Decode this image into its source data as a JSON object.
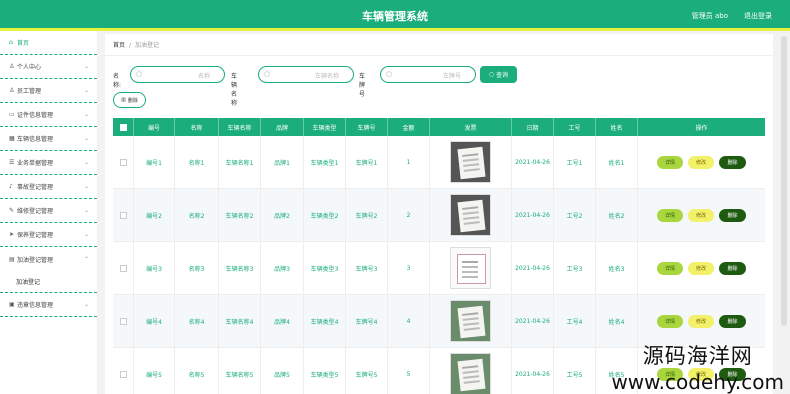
{
  "app": {
    "title": "车辆管理系统",
    "user": "管理员 abo",
    "logout": "退出登录"
  },
  "sidebar": {
    "items": [
      {
        "label": "首页",
        "icon": "home-icon"
      },
      {
        "label": "个人中心",
        "icon": "user-icon"
      },
      {
        "label": "员工管理",
        "icon": "users-icon"
      },
      {
        "label": "证件信息管理",
        "icon": "document-icon"
      },
      {
        "label": "车辆信息管理",
        "icon": "grid-icon"
      },
      {
        "label": "业务单据管理",
        "icon": "list-icon"
      },
      {
        "label": "事故登记管理",
        "icon": "mic-icon"
      },
      {
        "label": "维修登记管理",
        "icon": "wrench-icon"
      },
      {
        "label": "保养登记管理",
        "icon": "send-icon"
      },
      {
        "label": "加油登记管理",
        "icon": "fuel-icon"
      },
      {
        "label": "违章信息管理",
        "icon": "warning-icon"
      }
    ],
    "sub_item": "加油登记"
  },
  "breadcrumb": {
    "home": "首页",
    "sep": "/",
    "current": "加油登记"
  },
  "search": {
    "fields": [
      {
        "label": "名称:",
        "placeholder": "名称"
      },
      {
        "label": "车辆名称",
        "placeholder": "车辆名称"
      },
      {
        "label": "车牌号",
        "placeholder": "车牌号"
      }
    ],
    "query_label": "查询"
  },
  "toolbar": {
    "delete_label": "删除"
  },
  "table": {
    "headers": [
      "编号",
      "名称",
      "车辆名称",
      "品牌",
      "车辆类型",
      "车牌号",
      "金额",
      "发票",
      "日期",
      "工号",
      "姓名",
      "操作"
    ],
    "rows": [
      {
        "bianhao": "编号1",
        "mingcheng": "名称1",
        "cheliang": "车辆名称1",
        "pinpai": "品牌1",
        "leixing": "车辆类型1",
        "chepai": "车牌号1",
        "jine": "1",
        "riqi": "2021-04-26",
        "gonghao": "工号1",
        "xingming": "姓名1"
      },
      {
        "bianhao": "编号2",
        "mingcheng": "名称2",
        "cheliang": "车辆名称2",
        "pinpai": "品牌2",
        "leixing": "车辆类型2",
        "chepai": "车牌号2",
        "jine": "2",
        "riqi": "2021-04-26",
        "gonghao": "工号2",
        "xingming": "姓名2"
      },
      {
        "bianhao": "编号3",
        "mingcheng": "名称3",
        "cheliang": "车辆名称3",
        "pinpai": "品牌3",
        "leixing": "车辆类型3",
        "chepai": "车牌号3",
        "jine": "3",
        "riqi": "2021-04-26",
        "gonghao": "工号3",
        "xingming": "姓名3"
      },
      {
        "bianhao": "编号4",
        "mingcheng": "名称4",
        "cheliang": "车辆名称4",
        "pinpai": "品牌4",
        "leixing": "车辆类型4",
        "chepai": "车牌号4",
        "jine": "4",
        "riqi": "2021-04-26",
        "gonghao": "工号4",
        "xingming": "姓名4"
      },
      {
        "bianhao": "编号5",
        "mingcheng": "名称5",
        "cheliang": "车辆名称5",
        "pinpai": "品牌5",
        "leixing": "车辆类型5",
        "chepai": "车牌号5",
        "jine": "5",
        "riqi": "2021-04-26",
        "gonghao": "工号5",
        "xingming": "姓名5"
      }
    ],
    "actions": {
      "detail": "详情",
      "edit": "修改",
      "delete": "删除"
    }
  },
  "watermark": {
    "line1": "源码海洋网",
    "line2": "www.codehy.com"
  },
  "colors": {
    "accent": "#1bad7c",
    "topbar_underline": "#e5f33b"
  }
}
